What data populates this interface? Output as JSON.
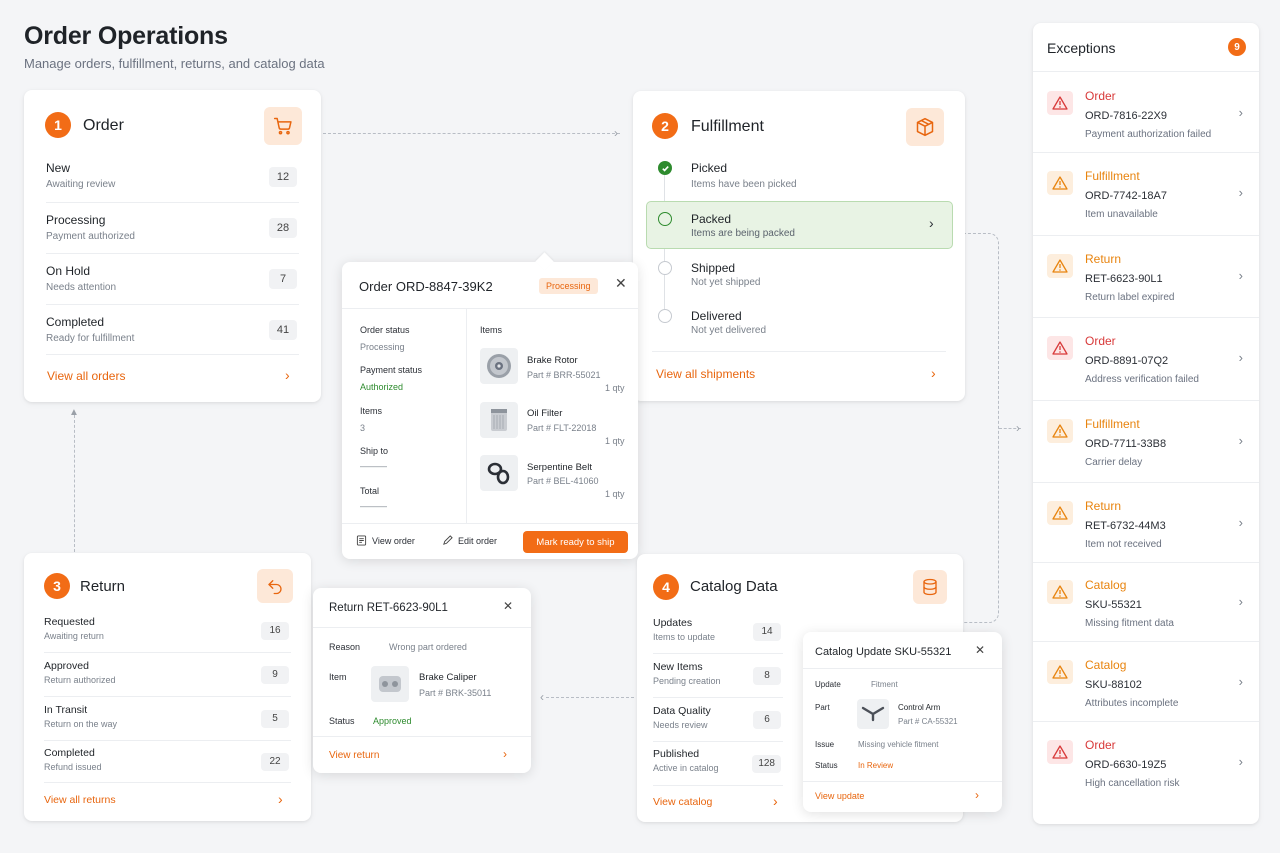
{
  "page": {
    "title": "Order Operations",
    "subtitle": "Manage orders, fulfillment, returns, and catalog data"
  },
  "colors": {
    "accent": "#f26c16",
    "success": "#2e8b2e",
    "danger": "#d83a3a",
    "warning": "#e8840f"
  },
  "order": {
    "number": "1",
    "title": "Order",
    "icon": "cart-icon",
    "rows": [
      {
        "title": "New",
        "sub": "Awaiting review",
        "count": "12"
      },
      {
        "title": "Processing",
        "sub": "Payment authorized",
        "count": "28"
      },
      {
        "title": "On Hold",
        "sub": "Needs attention",
        "count": "7"
      },
      {
        "title": "Completed",
        "sub": "Ready for fulfillment",
        "count": "41"
      }
    ],
    "link": "View all orders"
  },
  "fulfillment": {
    "number": "2",
    "title": "Fulfillment",
    "icon": "box-icon",
    "steps": [
      {
        "title": "Picked",
        "sub": "Items have been picked",
        "state": "done"
      },
      {
        "title": "Packed",
        "sub": "Items are being packed",
        "state": "active"
      },
      {
        "title": "Shipped",
        "sub": "Not yet shipped",
        "state": "pending"
      },
      {
        "title": "Delivered",
        "sub": "Not yet delivered",
        "state": "pending"
      }
    ],
    "link": "View all shipments"
  },
  "order_popup": {
    "title": "Order ORD-8847-39K2",
    "status_badge": "Processing",
    "fields": [
      {
        "label": "Order status",
        "value": "Processing"
      },
      {
        "label": "Payment status",
        "value": "Authorized"
      },
      {
        "label": "Items",
        "value": "3"
      },
      {
        "label": "Ship to",
        "value": "———"
      },
      {
        "label": "Total",
        "value": "———"
      }
    ],
    "items_header": "Items",
    "items": [
      {
        "name": "Brake Rotor",
        "part": "Part # BRR-55021",
        "qty": "1 qty",
        "icon": "brake-rotor-icon"
      },
      {
        "name": "Oil Filter",
        "part": "Part # FLT-22018",
        "qty": "1 qty",
        "icon": "oil-filter-icon"
      },
      {
        "name": "Serpentine Belt",
        "part": "Part # BEL-41060",
        "qty": "1 qty",
        "icon": "belt-icon"
      }
    ],
    "view_label": "View order",
    "edit_label": "Edit order",
    "primary_label": "Mark ready to ship"
  },
  "return": {
    "number": "3",
    "title": "Return",
    "icon": "return-icon",
    "rows": [
      {
        "title": "Requested",
        "sub": "Awaiting return",
        "count": "16"
      },
      {
        "title": "Approved",
        "sub": "Return authorized",
        "count": "9"
      },
      {
        "title": "In Transit",
        "sub": "Return on the way",
        "count": "5"
      },
      {
        "title": "Completed",
        "sub": "Refund issued",
        "count": "22"
      }
    ],
    "link": "View all returns"
  },
  "return_popup": {
    "title": "Return RET-6623-90L1",
    "reason_label": "Reason",
    "reason_value": "Wrong part ordered",
    "item_label": "Item",
    "item_name": "Brake Caliper",
    "item_part": "Part # BRK-35011",
    "status_label": "Status",
    "status_value": "Approved",
    "link": "View return"
  },
  "catalog": {
    "number": "4",
    "title": "Catalog Data",
    "icon": "database-icon",
    "rows": [
      {
        "title": "Updates",
        "sub": "Items to update",
        "count": "14"
      },
      {
        "title": "New Items",
        "sub": "Pending creation",
        "count": "8"
      },
      {
        "title": "Data Quality",
        "sub": "Needs review",
        "count": "6"
      },
      {
        "title": "Published",
        "sub": "Active in catalog",
        "count": "128"
      }
    ],
    "link": "View catalog"
  },
  "catalog_popup": {
    "title": "Catalog Update SKU-55321",
    "update_label": "Update",
    "update_value": "Fitment",
    "part_label": "Part",
    "part_name": "Control Arm",
    "part_number": "Part # CA-55321",
    "issue_label": "Issue",
    "issue_value": "Missing vehicle fitment",
    "status_label": "Status",
    "status_value": "In Review",
    "link": "View update"
  },
  "exceptions": {
    "title": "Exceptions",
    "count": "9",
    "items": [
      {
        "category": "Order",
        "id": "ORD-7816-22X9",
        "desc": "Payment authorization failed",
        "severity": "danger"
      },
      {
        "category": "Fulfillment",
        "id": "ORD-7742-18A7",
        "desc": "Item unavailable",
        "severity": "warning"
      },
      {
        "category": "Return",
        "id": "RET-6623-90L1",
        "desc": "Return label expired",
        "severity": "warning"
      },
      {
        "category": "Order",
        "id": "ORD-8891-07Q2",
        "desc": "Address verification failed",
        "severity": "danger"
      },
      {
        "category": "Fulfillment",
        "id": "ORD-7711-33B8",
        "desc": "Carrier delay",
        "severity": "warning"
      },
      {
        "category": "Return",
        "id": "RET-6732-44M3",
        "desc": "Item not received",
        "severity": "warning"
      },
      {
        "category": "Catalog",
        "id": "SKU-55321",
        "desc": "Missing fitment data",
        "severity": "warning"
      },
      {
        "category": "Catalog",
        "id": "SKU-88102",
        "desc": "Attributes incomplete",
        "severity": "warning"
      },
      {
        "category": "Order",
        "id": "ORD-6630-19Z5",
        "desc": "High cancellation risk",
        "severity": "danger"
      }
    ]
  }
}
